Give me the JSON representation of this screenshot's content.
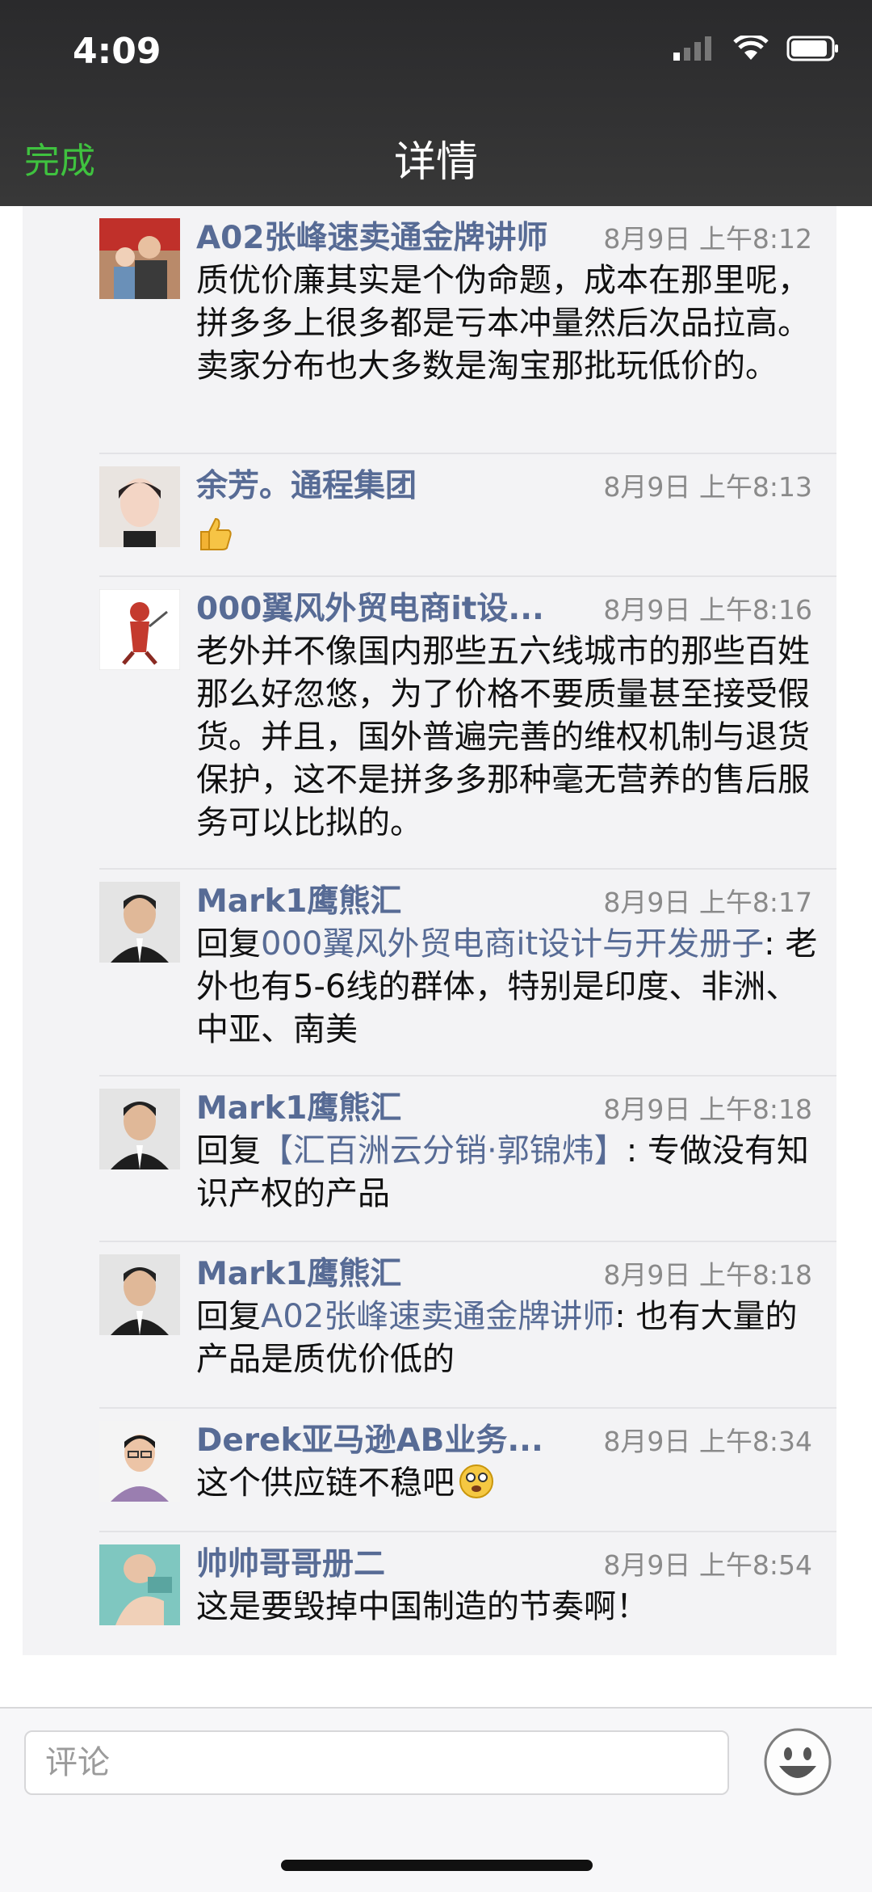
{
  "status_bar": {
    "time": "4:09",
    "icons": [
      "cellular-signal-icon",
      "wifi-icon",
      "battery-icon"
    ]
  },
  "navbar": {
    "back_label": "完成",
    "title": "详情"
  },
  "comments": [
    {
      "author": "A02张峰速卖通金牌讲师",
      "time": "8月9日 上午8:12",
      "text": "质优价廉其实是个伪命题，成本在那里呢，拼多多上很多都是亏本冲量然后次品拉高。卖家分布也大多数是淘宝那批玩低价的。"
    },
    {
      "author": "余芳。通程集团",
      "time": "8月9日 上午8:13",
      "emoji": "thumbs-up-icon"
    },
    {
      "author": "000翼风外贸电商it设...",
      "time": "8月9日 上午8:16",
      "text": "老外并不像国内那些五六线城市的那些百姓那么好忽悠，为了价格不要质量甚至接受假货。并且，国外普遍完善的维权机制与退货保护，这不是拼多多那种毫无营养的售后服务可以比拟的。"
    },
    {
      "author": "Mark1鹰熊汇",
      "time": "8月9日 上午8:17",
      "reply_prefix": "回复",
      "reply_to": "000翼风外贸电商it设计与开发册子",
      "text": ": 老外也有5-6线的群体，特别是印度、非洲、中亚、南美"
    },
    {
      "author": "Mark1鹰熊汇",
      "time": "8月9日 上午8:18",
      "reply_prefix": "回复",
      "reply_to": "【汇百洲云分销·郭锦炜】",
      "text": ": 专做没有知识产权的产品"
    },
    {
      "author": "Mark1鹰熊汇",
      "time": "8月9日 上午8:18",
      "reply_prefix": "回复",
      "reply_to": "A02张峰速卖通金牌讲师",
      "text": ": 也有大量的产品是质优价低的"
    },
    {
      "author": "Derek亚马逊AB业务...",
      "time": "8月9日 上午8:34",
      "text": "这个供应链不稳吧",
      "emoji": "dizzy-face-emoji-icon"
    },
    {
      "author": "帅帅哥哥册二",
      "time": "8月9日 上午8:54",
      "text": "这是要毁掉中国制造的节奏啊！"
    }
  ],
  "composer": {
    "placeholder": "评论",
    "emoji_button": "smiley-face-icon"
  },
  "colors": {
    "nav_bg": "#333333",
    "link": "#576b95",
    "accent_green": "#3fc23f",
    "panel_bg": "#f3f3f5"
  }
}
